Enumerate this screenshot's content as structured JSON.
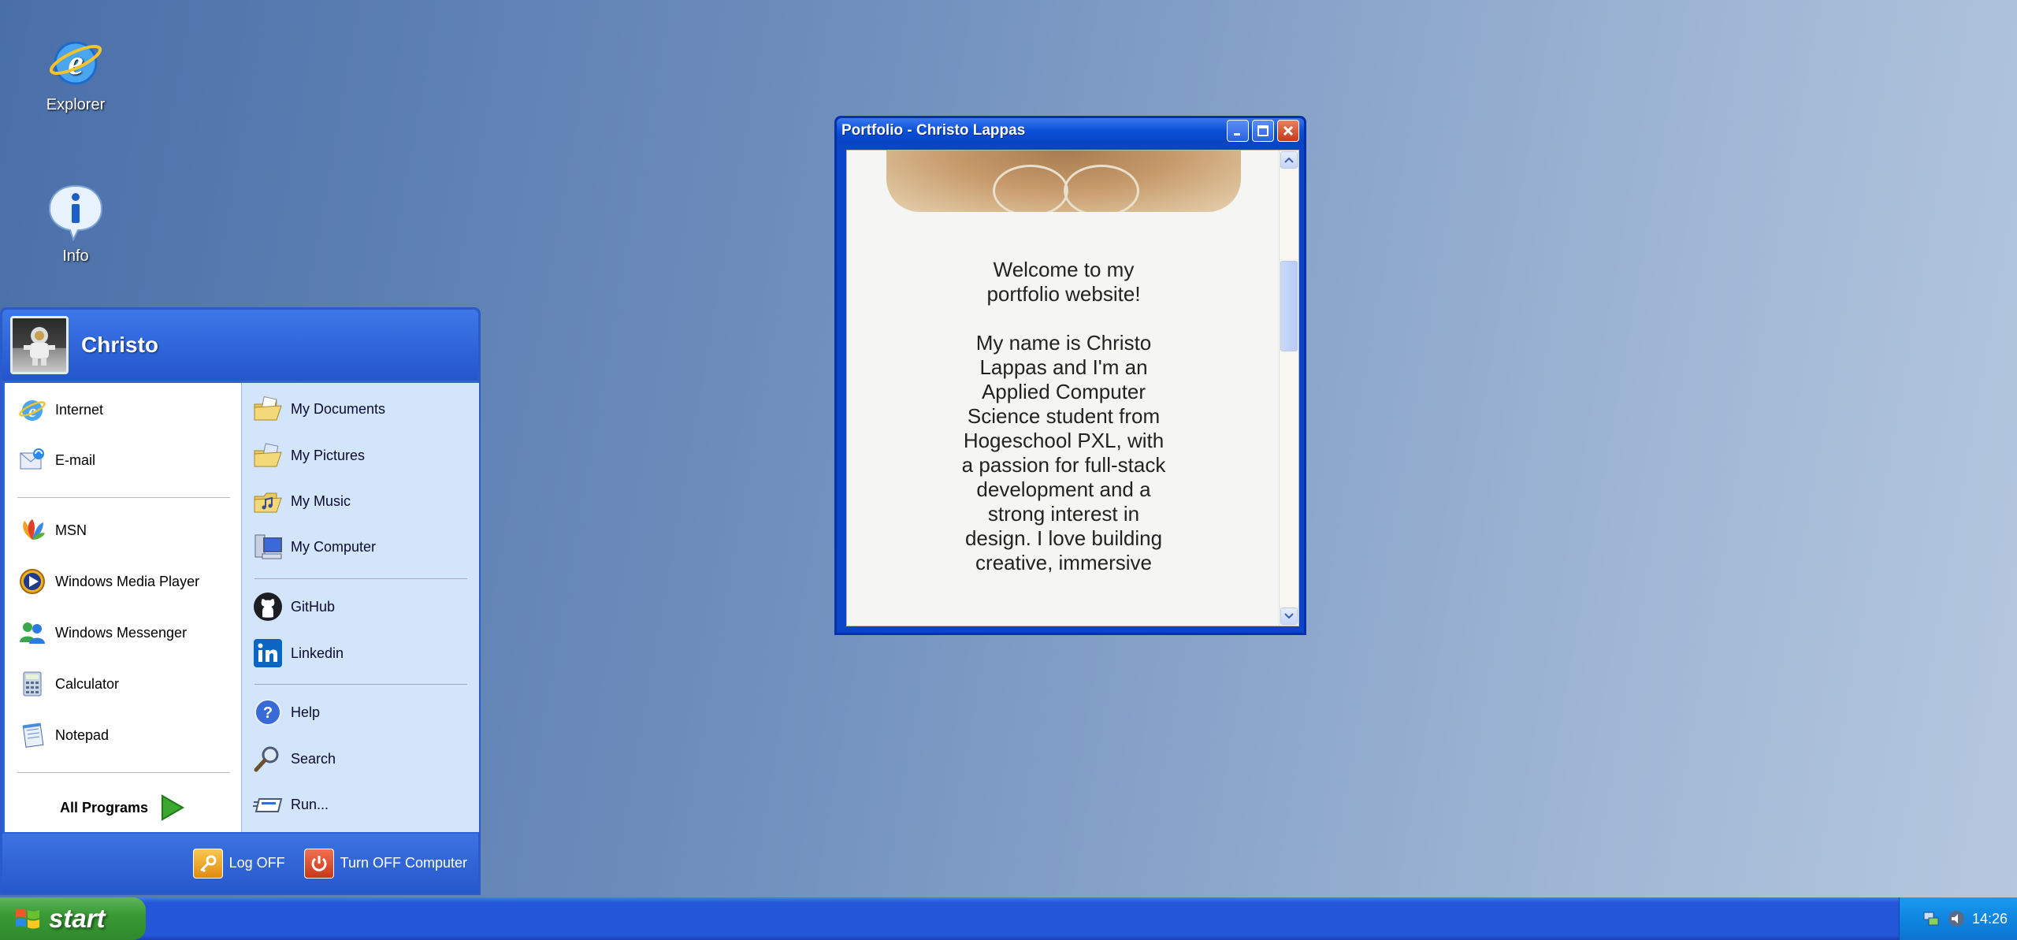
{
  "desktop": {
    "icons": [
      {
        "label": "Explorer",
        "icon": "internet-explorer-icon"
      },
      {
        "label": "Info",
        "icon": "info-icon"
      }
    ]
  },
  "window": {
    "title": "Portfolio - Christo Lappas",
    "content": {
      "welcome": "Welcome to my portfolio website!",
      "paragraph": "My name is Christo Lappas and I'm an Applied Computer Science student from Hogeschool PXL, with a passion for full-stack development and a strong interest in design. I love building creative, immersive"
    }
  },
  "start_menu": {
    "user": "Christo",
    "left_items": [
      {
        "label": "Internet",
        "icon": "internet-explorer-icon"
      },
      {
        "label": "E-mail",
        "icon": "email-icon"
      },
      {
        "label": "MSN",
        "icon": "msn-icon"
      },
      {
        "label": "Windows Media Player",
        "icon": "media-player-icon"
      },
      {
        "label": "Windows Messenger",
        "icon": "messenger-icon"
      },
      {
        "label": "Calculator",
        "icon": "calculator-icon"
      },
      {
        "label": "Notepad",
        "icon": "notepad-icon"
      }
    ],
    "all_programs": "All Programs",
    "right_items": [
      {
        "label": "My Documents",
        "icon": "folder-documents-icon"
      },
      {
        "label": "My Pictures",
        "icon": "folder-pictures-icon"
      },
      {
        "label": "My Music",
        "icon": "folder-music-icon"
      },
      {
        "label": "My Computer",
        "icon": "computer-icon"
      },
      {
        "label": "GitHub",
        "icon": "github-icon"
      },
      {
        "label": "Linkedin",
        "icon": "linkedin-icon"
      },
      {
        "label": "Help",
        "icon": "help-icon"
      },
      {
        "label": "Search",
        "icon": "search-icon"
      },
      {
        "label": "Run...",
        "icon": "run-icon"
      }
    ],
    "log_off": "Log OFF",
    "turn_off": "Turn OFF Computer"
  },
  "taskbar": {
    "start_label": "start",
    "clock": "14:26"
  }
}
